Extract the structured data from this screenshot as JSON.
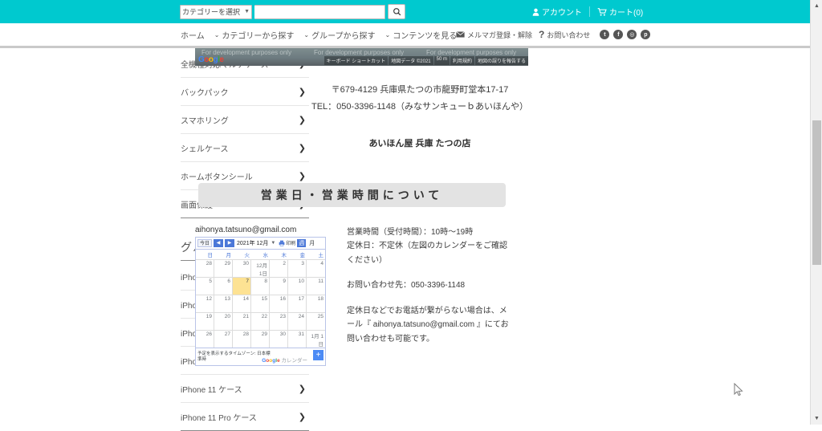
{
  "theme": {
    "accent": "#00c9cf",
    "calendar_blue": "#4c78d8",
    "today_bg": "#fde293"
  },
  "topbar": {
    "category_select": {
      "label": "カテゴリーを選択",
      "caret": "▼"
    },
    "search_input": {
      "value": "",
      "placeholder": ""
    },
    "search_button_icon": "search-icon",
    "account": {
      "label": "アカウント",
      "icon": "user-icon"
    },
    "cart": {
      "label": "カート(0)",
      "icon": "cart-icon"
    }
  },
  "nav": {
    "items": [
      {
        "label": "ホーム",
        "caret": ""
      },
      {
        "label": "カテゴリーから探す",
        "caret": "⌄"
      },
      {
        "label": "グループから探す",
        "caret": "⌄"
      },
      {
        "label": "コンテンツを見る",
        "caret": "⌄"
      }
    ],
    "utility": [
      {
        "label": "メルマガ登録・解除",
        "icon": "mail-icon"
      },
      {
        "label": "お問い合わせ",
        "icon": "question-icon"
      }
    ],
    "socials": [
      {
        "name": "twitter-icon",
        "glyph": "t"
      },
      {
        "name": "facebook-icon",
        "glyph": "f"
      },
      {
        "name": "instagram-icon",
        "glyph": "◎"
      },
      {
        "name": "pinterest-icon",
        "glyph": "p"
      }
    ]
  },
  "sidebar": {
    "categories": [
      {
        "label": "全機種対応マルチケース",
        "arrow": "❯"
      },
      {
        "label": "バックパック",
        "arrow": "❯"
      },
      {
        "label": "スマホリング",
        "arrow": "❯"
      },
      {
        "label": "シェルケース",
        "arrow": "❯"
      },
      {
        "label": "ホームボタンシール",
        "arrow": "❯"
      },
      {
        "label": "画面保護",
        "arrow": "❯"
      }
    ],
    "group_title": "グループから探す",
    "groups": [
      {
        "label": "iPhone 12 Pro Max ケース",
        "arrow": "❯"
      },
      {
        "label": "iPhone 12 mini ケース",
        "arrow": "❯"
      },
      {
        "label": "iPhone 12 Pro ケース",
        "arrow": "❯"
      },
      {
        "label": "iPhone 12 ケース",
        "arrow": "❯"
      },
      {
        "label": "iPhone 11 ケース",
        "arrow": "❯"
      },
      {
        "label": "iPhone 11 Pro ケース",
        "arrow": "❯"
      }
    ]
  },
  "map": {
    "watermark": "For development purposes only",
    "logo": "Google",
    "buttons": [
      "キーボード ショートカット",
      "地図データ ©2021",
      "50 m",
      "利用規約",
      "地図の誤りを報告する"
    ]
  },
  "store": {
    "postal_address": "〒679-4129 兵庫県たつの市龍野町堂本17-17",
    "tel_line": "TEL：050-3396-1148（みなサンキューｂあいほんや）",
    "name": "あいほん屋 兵庫 たつの店"
  },
  "section": {
    "title": "営業日・営業時間について"
  },
  "calendar": {
    "email": "aihonya.tatsuno@gmail.com",
    "toolbar": {
      "today": "今日",
      "prev": "◀",
      "next": "▶",
      "month_title": "2021年 12月",
      "caret": "▼",
      "print": "印刷",
      "week_view": "週",
      "month_view": "月"
    },
    "weekdays": [
      "日",
      "月",
      "火",
      "水",
      "木",
      "金",
      "土"
    ],
    "cells": [
      "28",
      "29",
      "30",
      "12月 1日",
      "2",
      "3",
      "4",
      "5",
      "6",
      "7",
      "8",
      "9",
      "10",
      "11",
      "12",
      "13",
      "14",
      "15",
      "16",
      "17",
      "18",
      "19",
      "20",
      "21",
      "22",
      "23",
      "24",
      "25",
      "26",
      "27",
      "28",
      "29",
      "30",
      "31",
      "1月 1日"
    ],
    "today_index": 9,
    "footer": {
      "timezone": "予定を表示するタイムゾーン: 日本標準時",
      "brand": "Google カレンダー",
      "add_button": "+"
    }
  },
  "info": {
    "hours": "営業時間（受付時間）：10時〜19時",
    "holiday": "定休日：不定休（左図のカレンダーをご確認ください）",
    "contact": "お問い合わせ先：050-3396-1148",
    "note": "定休日などでお電話が繋がらない場合は、メール『 aihonya.tatsuno@gmail.com 』にてお問い合わせも可能です。"
  },
  "scrollbar": {
    "up": "▲",
    "down": "▼"
  }
}
